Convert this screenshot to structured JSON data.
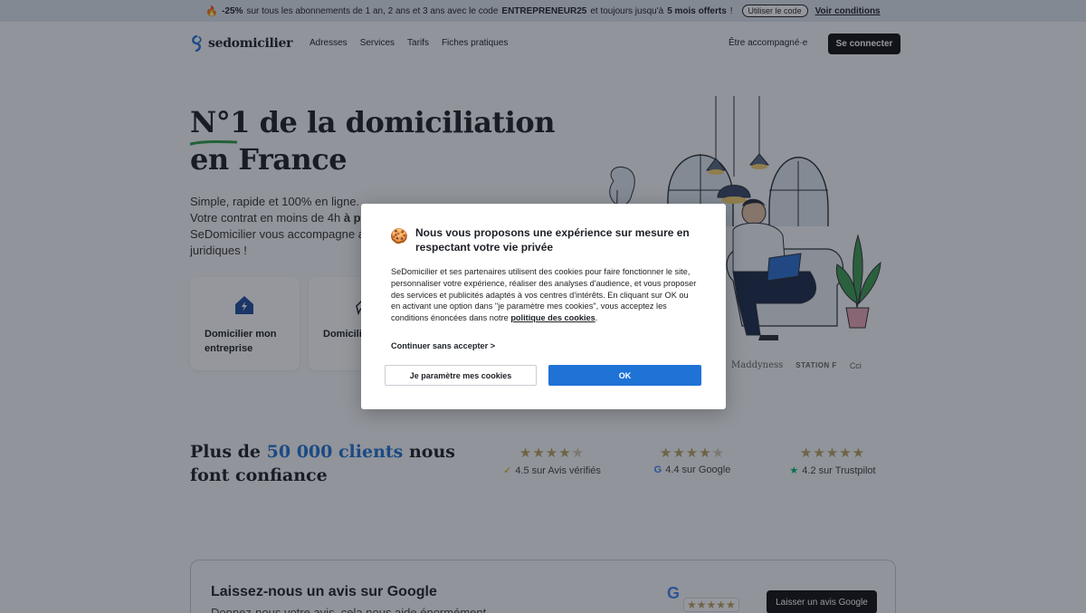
{
  "promo": {
    "icon": "fire-icon",
    "discount": "-25%",
    "text_1": "sur tous les abonnements de 1 an, 2 ans et 3 ans avec le code",
    "code": "ENTREPRENEUR25",
    "text_2": "et toujours jusqu'à",
    "highlight": "5 mois offerts",
    "text_3": "!",
    "use_code_label": "Utiliser le code",
    "conditions_label": "Voir conditions"
  },
  "header": {
    "logo_text": "sedomicilier",
    "nav": [
      "Adresses",
      "Services",
      "Tarifs",
      "Fiches pratiques"
    ],
    "accompagne_label": "Être accompagné·e",
    "login_label": "Se connecter"
  },
  "hero": {
    "title_line1": "N°1 de la domiciliation",
    "title_line2": "en France",
    "sub_line1": "Simple, rapide et 100% en ligne.",
    "sub_line2_start": "Votre contrat en moins de 4h",
    "sub_line2_bold": "à p",
    "sub_line3": "SeDomicilier vous accompagne a",
    "sub_line4": "juridiques !",
    "cards": [
      {
        "label": "Domicilier mon entreprise",
        "icon": "house-lightning-icon"
      },
      {
        "label": "Domicili Créatio",
        "icon": "pen-icon"
      }
    ]
  },
  "partners": [
    "Maddyness",
    "STATION F",
    "Cci"
  ],
  "trust": {
    "title_start": "Plus de",
    "title_highlight": "50 000 clients",
    "title_end": "nous font confiance",
    "ratings": [
      {
        "stars": "★★★★",
        "half": "★",
        "source": "4.5 sur Avis vérifiés",
        "icon": "avis-verifies-icon",
        "icon_glyph": "✓"
      },
      {
        "stars": "★★★★",
        "half": "★",
        "source": "4.4 sur Google",
        "icon": "google-icon",
        "icon_glyph": "G"
      },
      {
        "stars": "★★★★★",
        "half": "",
        "source": "4.2 sur Trustpilot",
        "icon": "trustpilot-icon",
        "icon_glyph": "★"
      }
    ]
  },
  "google_box": {
    "title": "Laissez-nous un avis sur Google",
    "subtitle": "Donnez-nous votre avis, cela nous aide énormément",
    "g_letter": "G",
    "stars": "★★★★★",
    "button_label": "Laisser un avis Google"
  },
  "cookie_modal": {
    "icon": "cookie-icon",
    "title": "Nous vous proposons une expérience sur mesure en respectant votre vie privée",
    "body": "SeDomicilier et ses partenaires utilisent des cookies pour faire fonctionner le site, personnaliser votre expérience, réaliser des analyses d'audience, et vous proposer des services et publicités adaptés à vos centres d'intérêts. En cliquant sur OK ou en activant une option dans \"je paramètre mes cookies\", vous acceptez les conditions énoncées dans notre",
    "policy_link": "politique des cookies",
    "body_end": ".",
    "continue_label": "Continuer sans accepter >",
    "param_button": "Je paramètre mes cookies",
    "ok_button": "OK"
  },
  "colors": {
    "accent": "#1f73d6",
    "dark_button": "#111111",
    "star": "#b9a262",
    "overlay": "rgba(20,25,35,0.45)"
  }
}
